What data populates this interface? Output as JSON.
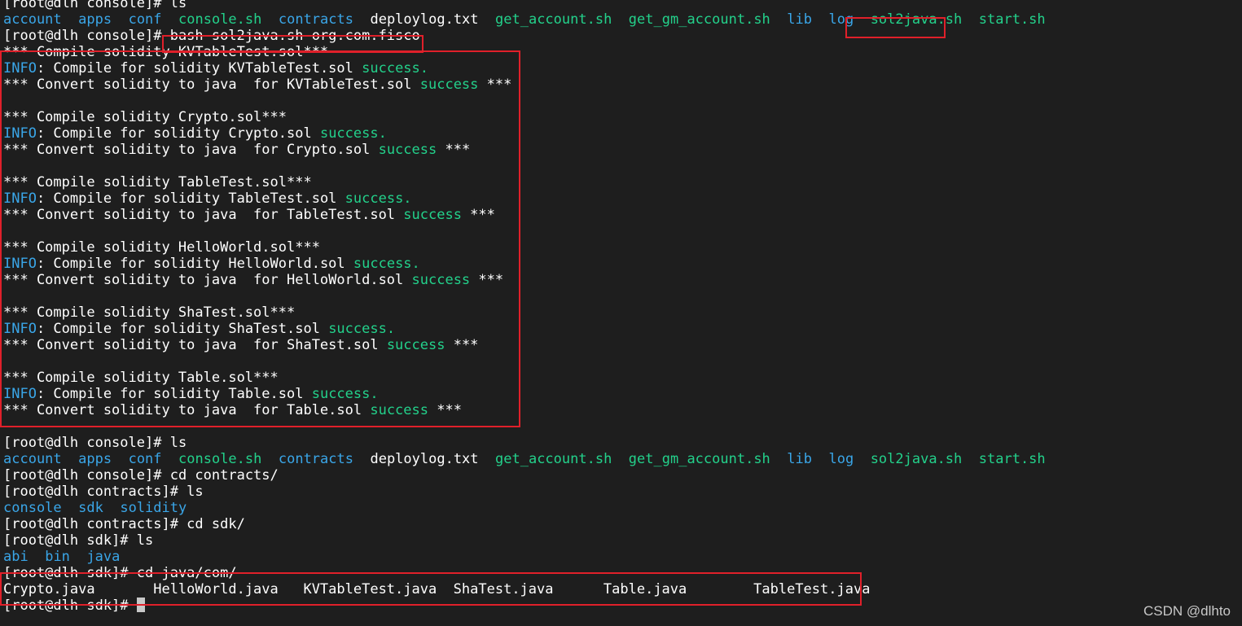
{
  "prompt_console": "[root@dlh console]# ",
  "prompt_contracts": "[root@dlh contracts]# ",
  "prompt_sdk": "[root@dlh sdk]# ",
  "cmd": {
    "ls": "ls",
    "bash": "bash sol2java.sh org.com.fisco",
    "cd_contracts": "cd contracts/",
    "cd_sdk": "cd sdk/",
    "cd_java": "cd java/com/"
  },
  "console_listing": {
    "account": "account",
    "apps": "apps",
    "conf": "conf",
    "console_sh": "console.sh",
    "contracts": "contracts",
    "deploylog": "deploylog.txt",
    "get_account": "get_account.sh",
    "get_gm_account": "get_gm_account.sh",
    "lib": "lib",
    "log": "log",
    "sol2java": "sol2java.sh",
    "start": "start.sh"
  },
  "compile_blocks": [
    {
      "compile": "*** Compile solidity KVTableTest.sol***",
      "info_prefix": "INFO",
      "info_text": ": Compile for solidity KVTableTest.sol ",
      "convert": "*** Convert solidity to java  for KVTableTest.sol ",
      "success": "success",
      "info_success": "success.",
      "tail": " ***"
    },
    {
      "compile": "*** Compile solidity Crypto.sol***",
      "info_prefix": "INFO",
      "info_text": ": Compile for solidity Crypto.sol ",
      "convert": "*** Convert solidity to java  for Crypto.sol ",
      "success": "success",
      "info_success": "success.",
      "tail": " ***"
    },
    {
      "compile": "*** Compile solidity TableTest.sol***",
      "info_prefix": "INFO",
      "info_text": ": Compile for solidity TableTest.sol ",
      "convert": "*** Convert solidity to java  for TableTest.sol ",
      "success": "success",
      "info_success": "success.",
      "tail": " ***"
    },
    {
      "compile": "*** Compile solidity HelloWorld.sol***",
      "info_prefix": "INFO",
      "info_text": ": Compile for solidity HelloWorld.sol ",
      "convert": "*** Convert solidity to java  for HelloWorld.sol ",
      "success": "success",
      "info_success": "success.",
      "tail": " ***"
    },
    {
      "compile": "*** Compile solidity ShaTest.sol***",
      "info_prefix": "INFO",
      "info_text": ": Compile for solidity ShaTest.sol ",
      "convert": "*** Convert solidity to java  for ShaTest.sol ",
      "success": "success",
      "info_success": "success.",
      "tail": " ***"
    },
    {
      "compile": "*** Compile solidity Table.sol***",
      "info_prefix": "INFO",
      "info_text": ": Compile for solidity Table.sol ",
      "convert": "*** Convert solidity to java  for Table.sol ",
      "success": "success",
      "info_success": "success.",
      "tail": " ***"
    }
  ],
  "contracts_listing": {
    "console": "console",
    "sdk": "sdk",
    "solidity": "solidity"
  },
  "sdk_listing": {
    "abi": "abi",
    "bin": "bin",
    "java": "java"
  },
  "java_listing": "Crypto.java       HelloWorld.java   KVTableTest.java  ShaTest.java      Table.java        TableTest.java",
  "watermark": "CSDN @dlhto",
  "colors": {
    "background": "#1e1e1e",
    "directory": "#3aa6e8",
    "executable": "#23d18b",
    "highlight_box": "#e0202a"
  }
}
